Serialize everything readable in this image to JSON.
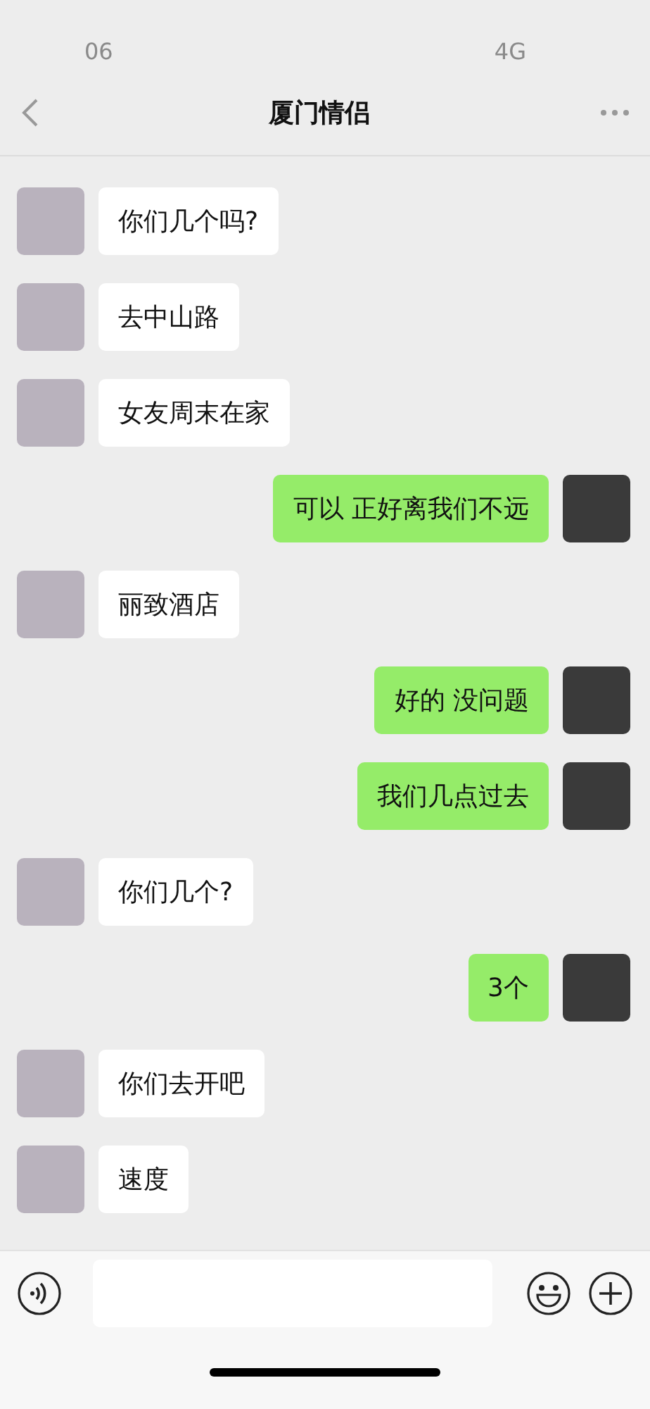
{
  "status_bar": {
    "time": "06",
    "network": "4G"
  },
  "nav": {
    "title": "厦门情侣"
  },
  "messages": [
    {
      "kind": "incoming",
      "text": "你们几个吗?"
    },
    {
      "kind": "incoming",
      "text": "去中山路"
    },
    {
      "kind": "incoming",
      "text": "女友周末在家"
    },
    {
      "kind": "outgoing",
      "text": "可以 正好离我们不远"
    },
    {
      "kind": "incoming",
      "text": "丽致酒店"
    },
    {
      "kind": "outgoing",
      "text": "好的 没问题"
    },
    {
      "kind": "outgoing",
      "text": "我们几点过去"
    },
    {
      "kind": "incoming",
      "text": "你们几个?"
    },
    {
      "kind": "outgoing",
      "text": "3个"
    },
    {
      "kind": "incoming",
      "text": "你们去开吧"
    },
    {
      "kind": "incoming",
      "text": "速度"
    }
  ]
}
